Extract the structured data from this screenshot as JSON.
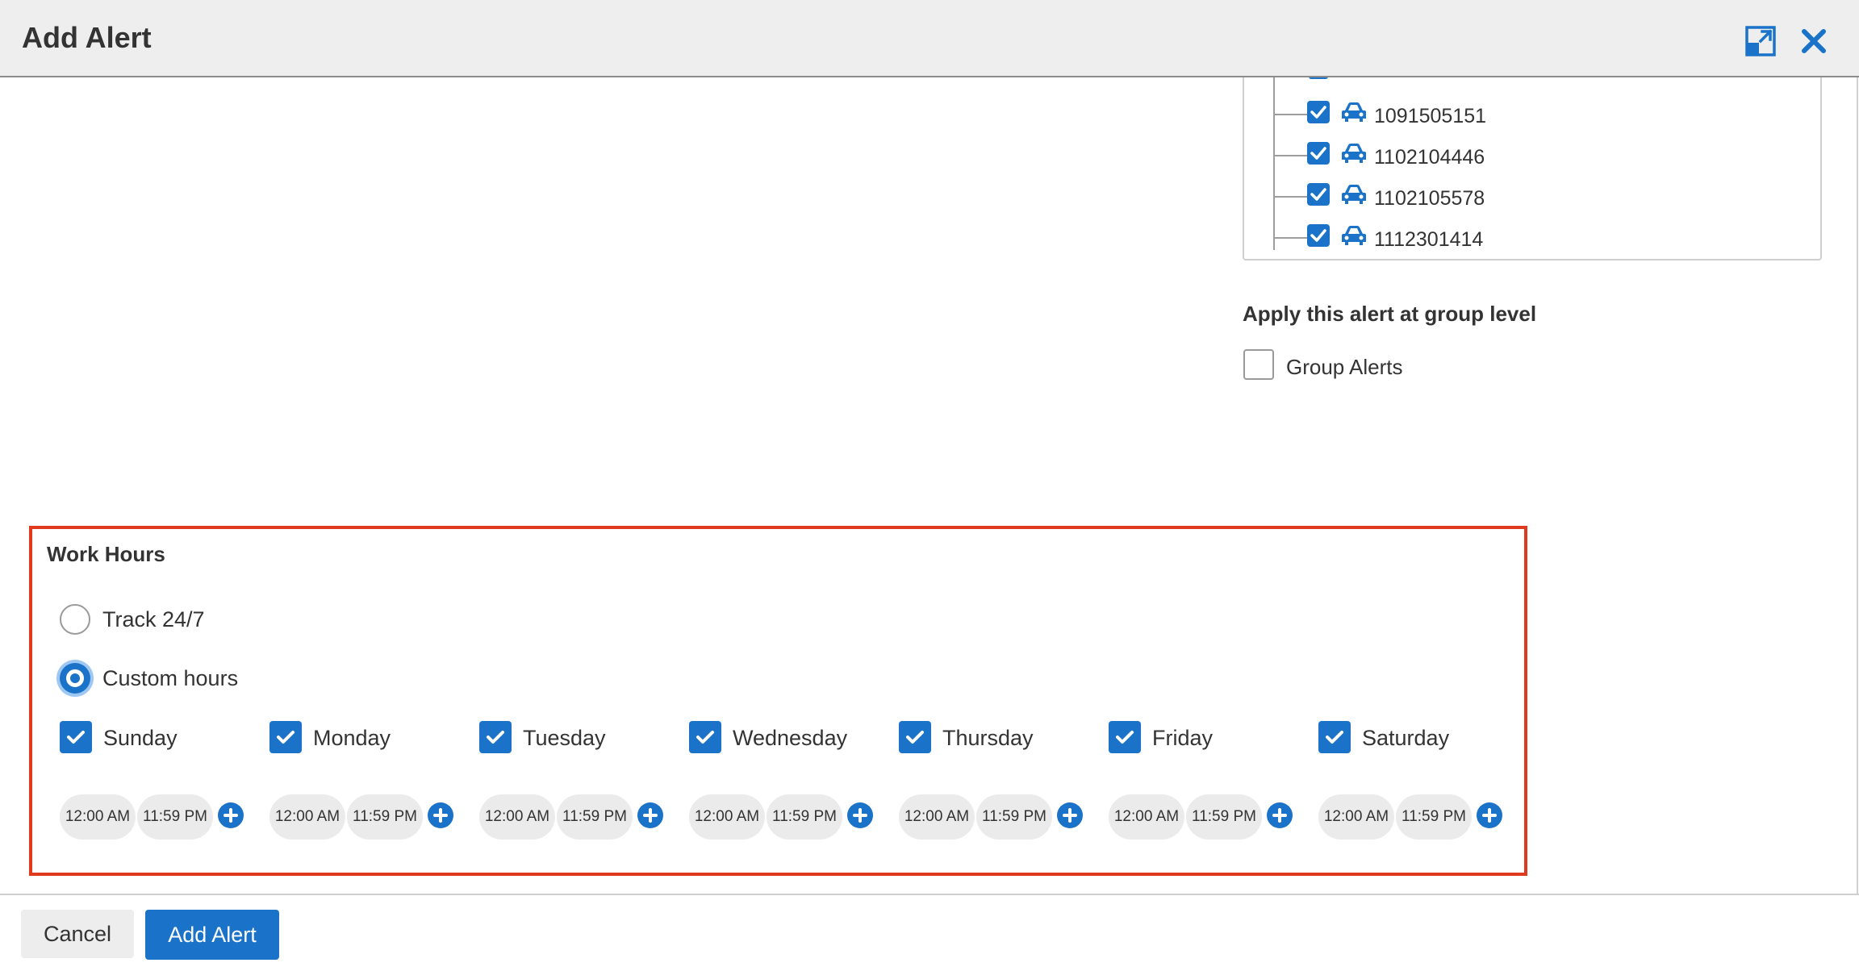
{
  "dialog": {
    "title": "Add Alert"
  },
  "vehicles": {
    "items": [
      {
        "id": "1091505151",
        "checked": true
      },
      {
        "id": "1102104446",
        "checked": true
      },
      {
        "id": "1102105578",
        "checked": true
      },
      {
        "id": "1112301414",
        "checked": true
      }
    ]
  },
  "group_level": {
    "heading": "Apply this alert at group level",
    "checkbox_label": "Group Alerts",
    "checked": false
  },
  "work_hours": {
    "title": "Work Hours",
    "options": [
      {
        "label": "Track 24/7",
        "selected": false
      },
      {
        "label": "Custom hours",
        "selected": true
      }
    ],
    "days": [
      {
        "name": "Sunday",
        "checked": true,
        "start": "12:00 AM",
        "end": "11:59 PM"
      },
      {
        "name": "Monday",
        "checked": true,
        "start": "12:00 AM",
        "end": "11:59 PM"
      },
      {
        "name": "Tuesday",
        "checked": true,
        "start": "12:00 AM",
        "end": "11:59 PM"
      },
      {
        "name": "Wednesday",
        "checked": true,
        "start": "12:00 AM",
        "end": "11:59 PM"
      },
      {
        "name": "Thursday",
        "checked": true,
        "start": "12:00 AM",
        "end": "11:59 PM"
      },
      {
        "name": "Friday",
        "checked": true,
        "start": "12:00 AM",
        "end": "11:59 PM"
      },
      {
        "name": "Saturday",
        "checked": true,
        "start": "12:00 AM",
        "end": "11:59 PM"
      }
    ]
  },
  "footer": {
    "cancel_label": "Cancel",
    "submit_label": "Add Alert"
  },
  "colors": {
    "accent": "#1a73c9",
    "highlight_border": "#e03a1e",
    "header_bg": "#eeeeee"
  }
}
